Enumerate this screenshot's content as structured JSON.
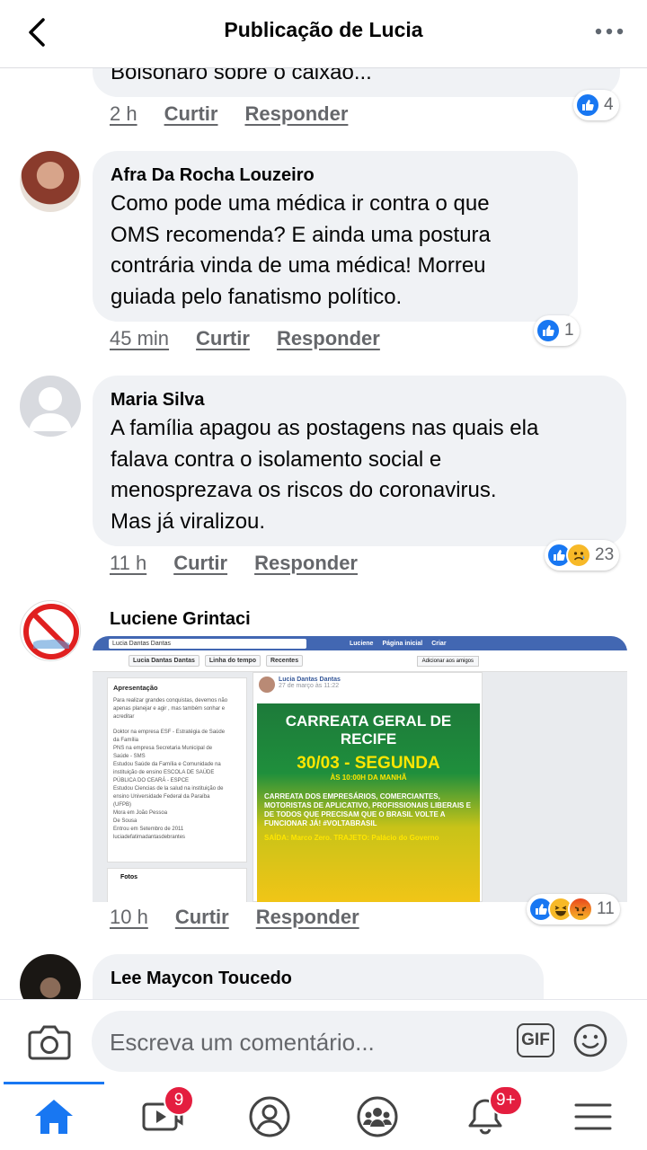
{
  "header": {
    "title": "Publicação de Lucia"
  },
  "comments": [
    {
      "text": "Bolsonaro sobre o caixão...",
      "time": "2 h",
      "like": "Curtir",
      "reply": "Responder",
      "reaction_count": "4"
    },
    {
      "author": "Afra Da Rocha Louzeiro",
      "lines": [
        "Como pode uma médica ir contra o que",
        "OMS recomenda? E ainda uma postura",
        "contrária vinda de uma médica!  Morreu",
        "guiada pelo fanatismo político."
      ],
      "time": "45 min",
      "like": "Curtir",
      "reply": "Responder",
      "reaction_count": "1"
    },
    {
      "author": "Maria Silva",
      "lines": [
        "A família apagou as postagens nas quais ela",
        "falava contra o isolamento social e",
        "menosprezava os riscos do coronavirus.",
        "Mas já viralizou."
      ],
      "time": "11 h",
      "like": "Curtir",
      "reply": "Responder",
      "reaction_count": "23"
    },
    {
      "author": "Luciene Grintaci",
      "time": "10 h",
      "like": "Curtir",
      "reply": "Responder",
      "reaction_count": "11",
      "image": {
        "search": "Lucia Dantas Dantas",
        "nav": [
          "Luciene",
          "Página inicial",
          "Criar"
        ],
        "tabs": [
          "Lucia Dantas Dantas",
          "Linha do tempo",
          "Recentes"
        ],
        "add_friend": "Adicionar aos amigos",
        "intro_title": "Apresentação",
        "intro_lines": [
          "Para realizar grandes conquistas, devemos não",
          "apenas planejar e agir , mas também sonhar e",
          "acreditar",
          "Doktor na empresa ESF - Estratégia de Saúde",
          "da Família",
          "PNS na empresa Secretaria Municipal de",
          "Saúde - SMS",
          "Estudou Saúde da Família e Comunidade na",
          "instituição de ensino ESCOLA DE SAÚDE",
          "PÚBLICA DO CEARÁ - ESPCE",
          "Estudou Ciencias de la salud na instituição de",
          "ensino Universidade Federal da Paraíba",
          "(UFPB)",
          "Mora em João Pessoa",
          "De Sousa",
          "Entrou em Setembro de 2011",
          "luciadefatimadantasdebrantes"
        ],
        "photos_label": "Fotos",
        "post_author": "Lucia Dantas Dantas",
        "post_date": "27 de março às 11:22",
        "poster_title": "CARREATA GERAL DE RECIFE",
        "poster_date": "30/03 - SEGUNDA",
        "poster_time": "ÀS 10:00H DA MANHÃ",
        "poster_body": "CARREATA DOS EMPRESÁRIOS, COMERCIANTES, MOTORISTAS DE APLICATIVO, PROFISSIONAIS LIBERAIS E DE TODOS QUE PRECISAM QUE O BRASIL VOLTE A FUNCIONAR JÁ! #VOLTABRASIL",
        "poster_exit": "SAÍDA: Marco Zero. TRAJETO: Palácio do Governo"
      }
    },
    {
      "author": "Lee Maycon Toucedo"
    }
  ],
  "composer": {
    "placeholder": "Escreva um comentário...",
    "gif_label": "GIF"
  },
  "tabbar": {
    "watch_badge": "9",
    "notifications_badge": "9+"
  },
  "colors": {
    "accent": "#1877f2",
    "bubble": "#f0f2f5",
    "badge": "#e41e3f"
  }
}
